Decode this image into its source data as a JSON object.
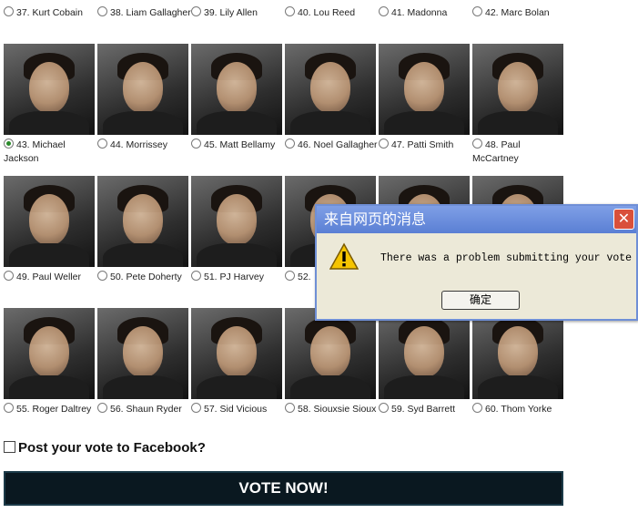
{
  "poll": {
    "candidates": [
      {
        "label": "37. Kurt Cobain",
        "selected": false
      },
      {
        "label": "38. Liam Gallagher",
        "selected": false
      },
      {
        "label": "39. Lily Allen",
        "selected": false
      },
      {
        "label": "40. Lou Reed",
        "selected": false
      },
      {
        "label": "41. Madonna",
        "selected": false
      },
      {
        "label": "42. Marc Bolan",
        "selected": false
      },
      {
        "label": "43. Michael Jackson",
        "selected": true
      },
      {
        "label": "44. Morrissey",
        "selected": false
      },
      {
        "label": "45. Matt Bellamy",
        "selected": false
      },
      {
        "label": "46. Noel Gallagher",
        "selected": false
      },
      {
        "label": "47. Patti Smith",
        "selected": false
      },
      {
        "label": "48. Paul McCartney",
        "selected": false
      },
      {
        "label": "49. Paul Weller",
        "selected": false
      },
      {
        "label": "50. Pete Doherty",
        "selected": false
      },
      {
        "label": "51. PJ Harvey",
        "selected": false
      },
      {
        "label": "52.",
        "selected": false
      },
      {
        "label": "",
        "selected": false
      },
      {
        "label": "",
        "selected": false
      },
      {
        "label": "55. Roger Daltrey",
        "selected": false
      },
      {
        "label": "56. Shaun Ryder",
        "selected": false
      },
      {
        "label": "57. Sid Vicious",
        "selected": false
      },
      {
        "label": "58. Siouxsie Sioux",
        "selected": false
      },
      {
        "label": "59. Syd Barrett",
        "selected": false
      },
      {
        "label": "60. Thom Yorke",
        "selected": false
      }
    ],
    "facebook_label": "Post your vote to Facebook?",
    "vote_button": "VOTE NOW!"
  },
  "dialog": {
    "title": "来自网页的消息",
    "message": "There was a problem submitting your vote",
    "ok_label": "确定",
    "close_symbol": "✕",
    "title_color": "#5a7fd4"
  },
  "icons": {
    "warning": "warning-icon",
    "close": "close-icon"
  }
}
